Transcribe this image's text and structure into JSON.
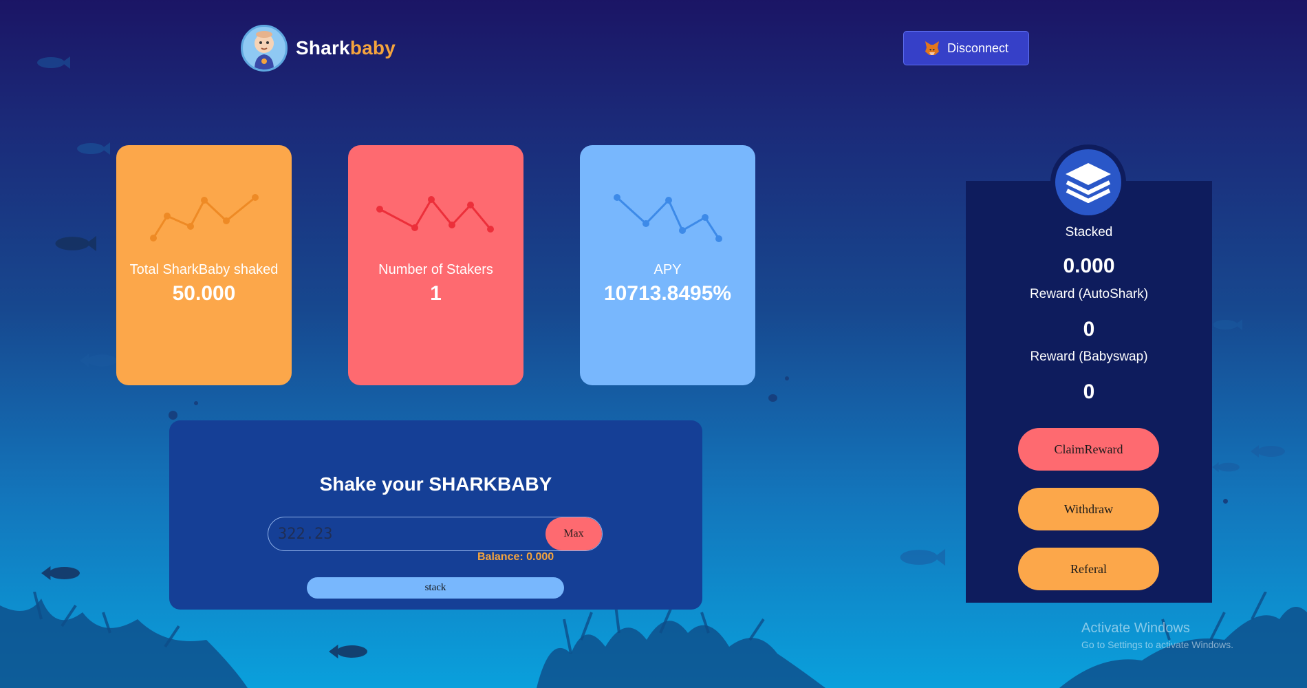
{
  "header": {
    "brand_part1": "Shark",
    "brand_part2": "baby",
    "disconnect_label": "Disconnect"
  },
  "stats": [
    {
      "label": "Total SharkBaby shaked",
      "value": "50.000",
      "color": "#fca74a",
      "line_color": "#ee8a25",
      "icon": "line-chart-icon"
    },
    {
      "label": "Number of Stakers",
      "value": "1",
      "color": "#fe6a70",
      "line_color": "#ec2f3a",
      "icon": "line-chart-icon"
    },
    {
      "label": "APY",
      "value": "10713.8495%",
      "color": "#78b7fd",
      "line_color": "#3d8ae8",
      "icon": "line-chart-icon"
    }
  ],
  "stake": {
    "title": "Shake your SHARKBABY",
    "amount_value": "322.23",
    "max_label": "Max",
    "balance_text": "Balance: 0.000",
    "stack_label": "stack"
  },
  "rewards": {
    "stacked_label": "Stacked",
    "stacked_value": "0.000",
    "autoshark_label": "Reward (AutoShark)",
    "autoshark_value": "0",
    "babyswap_label": "Reward (Babyswap)",
    "babyswap_value": "0",
    "claim_label": "ClaimReward",
    "withdraw_label": "Withdraw",
    "referal_label": "Referal",
    "icon": "layers-icon"
  },
  "watermark": {
    "line1": "Activate Windows",
    "line2": "Go to Settings to activate Windows."
  },
  "colors": {
    "accent_orange": "#fca74a",
    "accent_red": "#fe6a70",
    "accent_blue": "#78b7fd",
    "panel_navy": "#0e1c5d",
    "stake_panel": "#153f96",
    "disconnect": "#3640c8"
  }
}
